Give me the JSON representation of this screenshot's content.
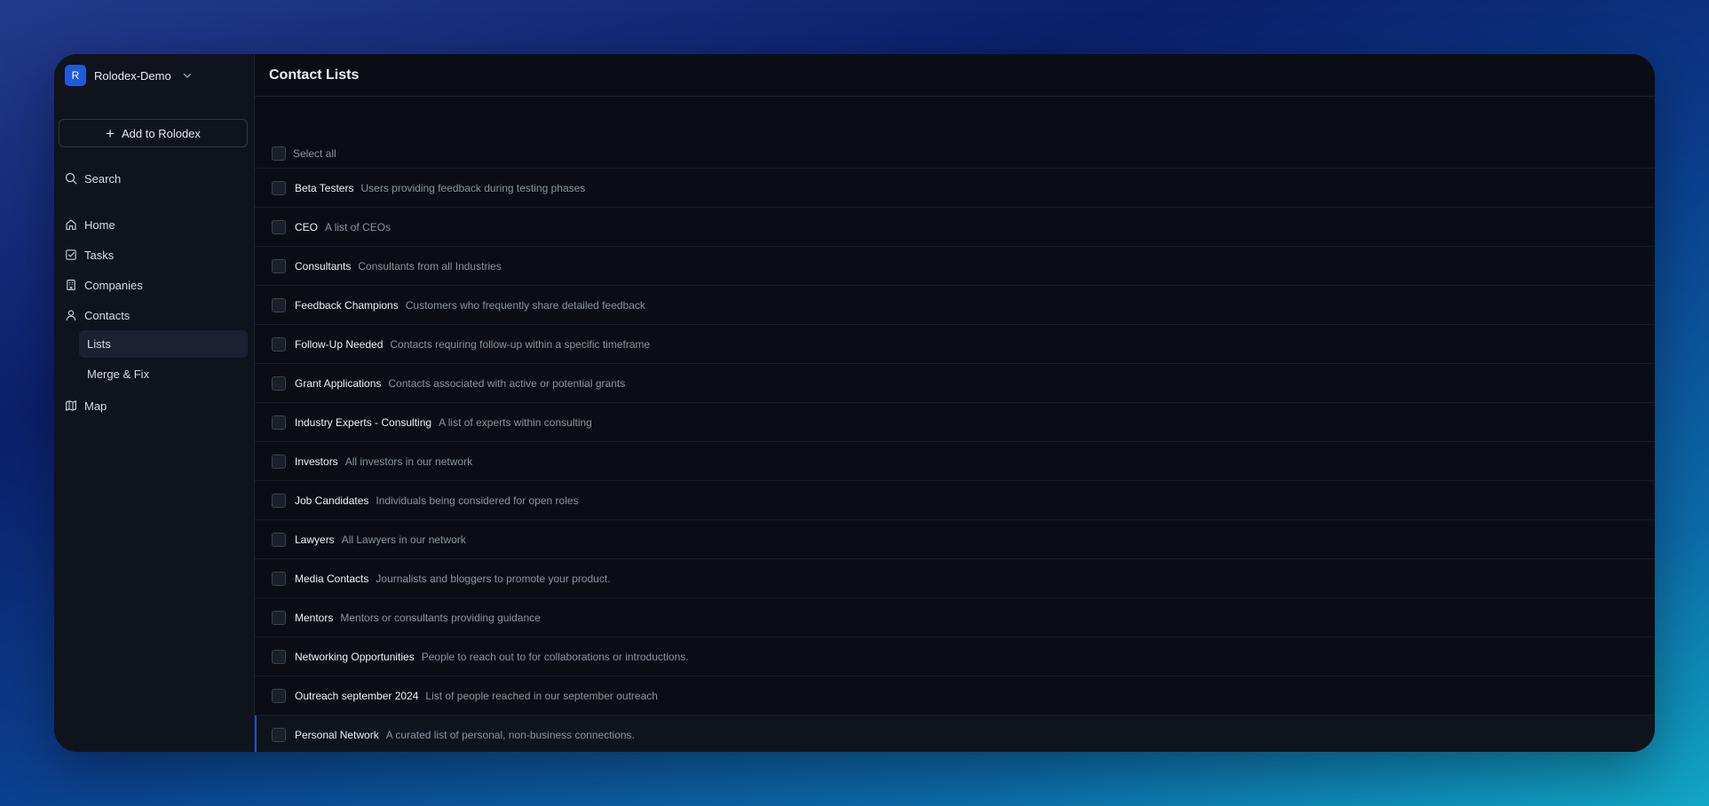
{
  "workspace": {
    "initial": "R",
    "name": "Rolodex-Demo"
  },
  "sidebar": {
    "add_label": "Add to Rolodex",
    "search_label": "Search",
    "home_label": "Home",
    "tasks_label": "Tasks",
    "companies_label": "Companies",
    "contacts_label": "Contacts",
    "lists_label": "Lists",
    "merge_label": "Merge & Fix",
    "map_label": "Map"
  },
  "main": {
    "title": "Contact Lists",
    "select_all_label": "Select all",
    "lists": [
      {
        "name": "Beta Testers",
        "description": "Users providing feedback during testing phases"
      },
      {
        "name": "CEO",
        "description": "A list of CEOs"
      },
      {
        "name": "Consultants",
        "description": "Consultants from all Industries"
      },
      {
        "name": "Feedback Champions",
        "description": "Customers who frequently share detailed feedback"
      },
      {
        "name": "Follow-Up Needed",
        "description": "Contacts requiring follow-up within a specific timeframe"
      },
      {
        "name": "Grant Applications",
        "description": "Contacts associated with active or potential grants"
      },
      {
        "name": "Industry Experts - Consulting",
        "description": "A list of experts within consulting"
      },
      {
        "name": "Investors",
        "description": "All investors in our network"
      },
      {
        "name": "Job Candidates",
        "description": "Individuals being considered for open roles"
      },
      {
        "name": "Lawyers",
        "description": "All Lawyers in our network"
      },
      {
        "name": "Media Contacts",
        "description": "Journalists and bloggers to promote your product."
      },
      {
        "name": "Mentors",
        "description": "Mentors or consultants providing guidance"
      },
      {
        "name": "Networking Opportunities",
        "description": "People to reach out to for collaborations or introductions."
      },
      {
        "name": "Outreach september 2024",
        "description": "List of people reached in our september outreach"
      },
      {
        "name": "Personal Network",
        "description": "A curated list of personal, non-business connections."
      }
    ]
  },
  "colors": {
    "accent": "#1f5bd8",
    "background": "#0a0e14",
    "sidebar": "#0f131c"
  }
}
